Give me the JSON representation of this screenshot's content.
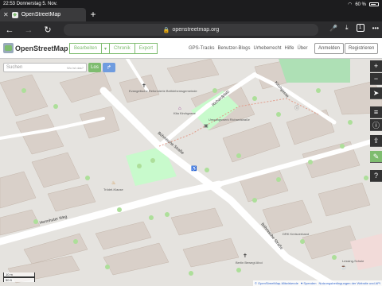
{
  "status_bar": {
    "time": "22:53",
    "date": "Donnerstag 5. Nov.",
    "battery": "60 %"
  },
  "tab": {
    "title": "OpenStreetMap",
    "close": "✕",
    "new": "+"
  },
  "toolbar": {
    "back": "←",
    "forward": "→",
    "reload": "↻",
    "url": "openstreetmap.org",
    "tabs": "1",
    "more": "•••"
  },
  "header": {
    "brand": "OpenStreetMap",
    "edit": "Bearbeiten",
    "edit_caret": "▾",
    "history": "Chronik",
    "export": "Export",
    "nav": [
      "GPS-Tracks",
      "Benutzer-Blogs",
      "Urheberrecht",
      "Hilfe",
      "Über"
    ],
    "login": "Anmelden",
    "register": "Registrieren"
  },
  "search": {
    "placeholder": "Suchen",
    "where": "Wo ist das?",
    "go": "Los",
    "route": "↱"
  },
  "map_controls": {
    "zoom_in": "+",
    "zoom_out": "−",
    "locate": "➤",
    "layers": "≡",
    "share": "⇪",
    "note": "✎",
    "query": "?"
  },
  "scale": {
    "metric": "10 m",
    "imperial": "50 ft"
  },
  "streets": {
    "bx_left": "Böhmische Straße",
    "bx_right": "Böhmische Straße",
    "herrnhuter": "Herrnhuter Weg",
    "kirchgasse": "Kirchgasse",
    "richard": "Richardplatz"
  },
  "pois": {
    "church": "Evangelische Reformierte Bethlehemsgemeinde",
    "kita": "Kita Kirchgasse",
    "jugend": "Umgangswerk Richardstraße",
    "restaurant": "Trödel-Klause",
    "berlin_school": "Berlin Bewegt Ahoi",
    "school_right": "Lessing-Schule",
    "doctor": "DRK Kreisverband"
  },
  "attribution": {
    "osm": "© OpenStreetMap-Mitwirkende",
    "donate": "♥ Spenden",
    "terms": "Nutzungsbedingungen der Website und API"
  },
  "colors": {
    "osm_green": "#7ebc6f",
    "road": "#ffffff",
    "building": "#d9d0c9",
    "park": "#c8facc",
    "ground": "#e5e3df",
    "tree": "#addf9a"
  }
}
